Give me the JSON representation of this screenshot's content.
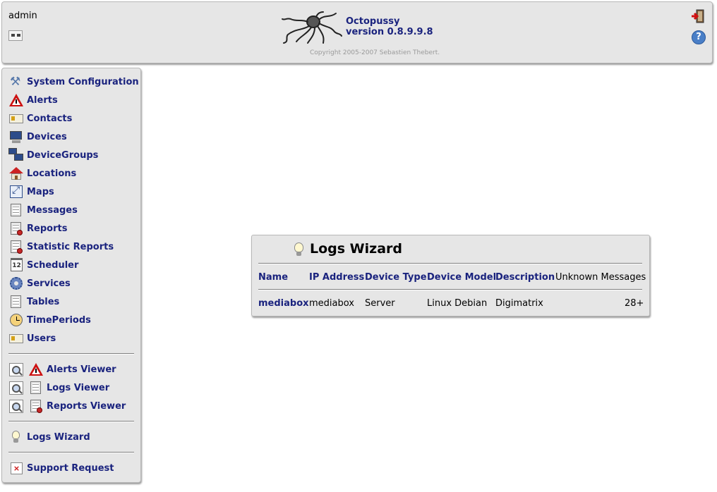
{
  "header": {
    "username": "admin",
    "app_name": "Octopussy",
    "version": "version 0.8.9.9.8",
    "copyright": "Copyright 2005-2007 Sebastien Thebert.",
    "help_glyph": "?"
  },
  "menu": {
    "main": [
      {
        "label": "System Configuration",
        "icon": "tools-icon"
      },
      {
        "label": "Alerts",
        "icon": "alert-icon"
      },
      {
        "label": "Contacts",
        "icon": "contact-card-icon"
      },
      {
        "label": "Devices",
        "icon": "monitor-icon"
      },
      {
        "label": "DeviceGroups",
        "icon": "device-groups-icon"
      },
      {
        "label": "Locations",
        "icon": "house-icon"
      },
      {
        "label": "Maps",
        "icon": "maps-icon"
      },
      {
        "label": "Messages",
        "icon": "document-icon"
      },
      {
        "label": "Reports",
        "icon": "report-icon"
      },
      {
        "label": "Statistic Reports",
        "icon": "report-icon"
      },
      {
        "label": "Scheduler",
        "icon": "calendar-icon",
        "glyph": "12"
      },
      {
        "label": "Services",
        "icon": "gear-icon"
      },
      {
        "label": "Tables",
        "icon": "document-icon"
      },
      {
        "label": "TimePeriods",
        "icon": "clock-icon"
      },
      {
        "label": "Users",
        "icon": "contact-card-icon"
      }
    ],
    "viewers": [
      {
        "label": "Alerts Viewer"
      },
      {
        "label": "Logs Viewer"
      },
      {
        "label": "Reports Viewer"
      }
    ],
    "wizard_label": "Logs Wizard",
    "support_label": "Support Request",
    "support_glyph": "×"
  },
  "wizard": {
    "title": "Logs Wizard",
    "columns": [
      "Name",
      "IP Address",
      "Device Type",
      "Device Model",
      "Description",
      "Unknown Messages"
    ],
    "rows": [
      {
        "name": "mediabox",
        "ip_address": "mediabox",
        "device_type": "Server",
        "device_model": "Linux Debian",
        "description": "Digimatrix",
        "unknown_messages": "28+"
      }
    ]
  },
  "colors": {
    "panel_bg": "#e6e6e6",
    "link_blue": "#1a237e",
    "alert_red": "#cc1111"
  }
}
